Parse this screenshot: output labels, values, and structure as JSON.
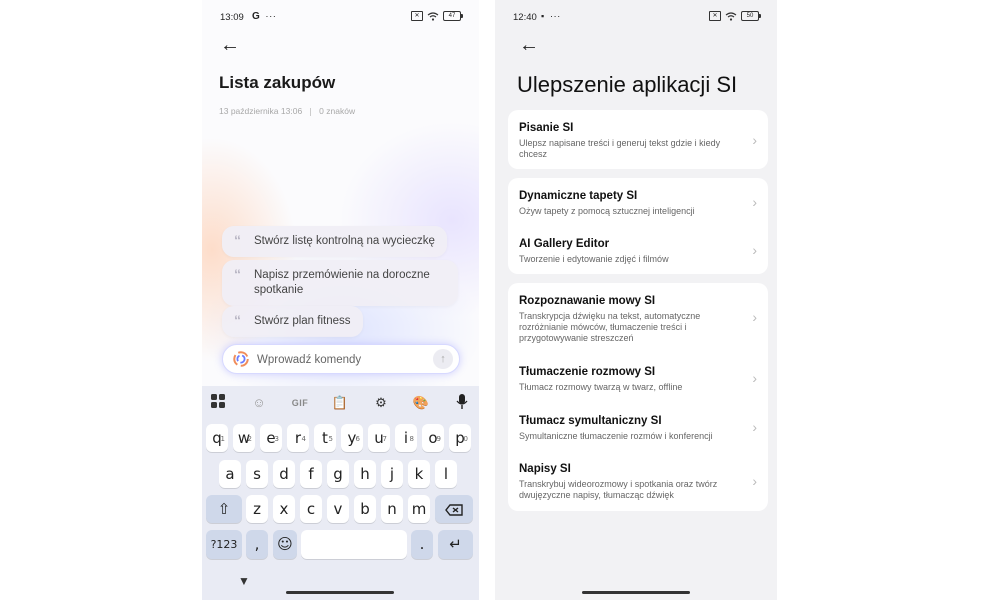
{
  "left_phone": {
    "status": {
      "time": "13:09",
      "app_glyph": "G",
      "dots": "···",
      "battery": "47"
    },
    "note": {
      "title": "Lista zakupów",
      "date": "13 października 13:06",
      "chars": "0 znaków"
    },
    "suggestions": [
      "Stwórz listę kontrolną na wycieczkę",
      "Napisz przemówienie na doroczne spotkanie",
      "Stwórz plan fitness"
    ],
    "command": {
      "placeholder": "Wprowadź komendy"
    },
    "keyboard": {
      "toolbar": {
        "gif_label": "GIF"
      },
      "row1": [
        {
          "key": "q",
          "hint": "1"
        },
        {
          "key": "w",
          "hint": "2"
        },
        {
          "key": "e",
          "hint": "3"
        },
        {
          "key": "r",
          "hint": "4"
        },
        {
          "key": "t",
          "hint": "5"
        },
        {
          "key": "y",
          "hint": "6"
        },
        {
          "key": "u",
          "hint": "7"
        },
        {
          "key": "i",
          "hint": "8"
        },
        {
          "key": "o",
          "hint": "9"
        },
        {
          "key": "p",
          "hint": "0"
        }
      ],
      "row2": [
        "a",
        "s",
        "d",
        "f",
        "g",
        "h",
        "j",
        "k",
        "l"
      ],
      "row3": [
        "z",
        "x",
        "c",
        "v",
        "b",
        "n",
        "m"
      ],
      "sym_label": "?123",
      "comma": ",",
      "period": "."
    }
  },
  "right_phone": {
    "status": {
      "time": "12:40",
      "dots": "···",
      "battery": "50"
    },
    "title": "Ulepszenie aplikacji SI",
    "groups": [
      [
        {
          "title": "Pisanie SI",
          "desc": "Ulepsz napisane treści i generuj tekst gdzie i kiedy chcesz"
        }
      ],
      [
        {
          "title": "Dynamiczne tapety SI",
          "desc": "Ożyw tapety z pomocą sztucznej inteligencji"
        },
        {
          "title": "AI Gallery Editor",
          "desc": "Tworzenie i edytowanie zdjęć i filmów"
        }
      ],
      [
        {
          "title": "Rozpoznawanie mowy SI",
          "desc": "Transkrypcja dźwięku na tekst, automatyczne rozróżnianie mówców, tłumaczenie treści i przygotowywanie streszczeń"
        },
        {
          "title": "Tłumaczenie rozmowy SI",
          "desc": "Tłumacz rozmowy twarzą w twarz, offline"
        },
        {
          "title": "Tłumacz symultaniczny SI",
          "desc": "Symultaniczne tłumaczenie rozmów i konferencji"
        },
        {
          "title": "Napisy SI",
          "desc": "Transkrybuj wideorozmowy i spotkania oraz twórz dwujęzyczne napisy, tłumacząc dźwięk"
        }
      ]
    ]
  }
}
